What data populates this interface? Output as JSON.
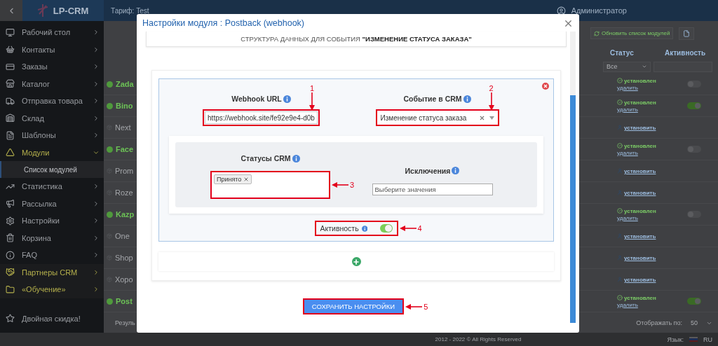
{
  "topbar": {
    "logo": "LP-CRM",
    "tariff": "Тариф: Test",
    "user": "Администратор"
  },
  "sidebar": {
    "items": [
      {
        "label": "Рабочий стол",
        "kind": "menu",
        "expanded": false
      },
      {
        "label": "Контакты",
        "kind": "menu",
        "expanded": false
      },
      {
        "label": "Заказы",
        "kind": "menu",
        "expanded": false
      },
      {
        "label": "Каталог",
        "kind": "menu",
        "expanded": false
      },
      {
        "label": "Отправка товара",
        "kind": "menu",
        "expanded": false
      },
      {
        "label": "Склад",
        "kind": "menu",
        "expanded": false
      },
      {
        "label": "Шаблоны",
        "kind": "menu",
        "expanded": false
      },
      {
        "label": "Модули",
        "kind": "accent",
        "expanded": true,
        "children": [
          {
            "label": "Список модулей",
            "selected": true
          }
        ]
      },
      {
        "label": "Статистика",
        "kind": "menu",
        "expanded": false
      },
      {
        "label": "Рассылка",
        "kind": "menu",
        "expanded": false
      },
      {
        "label": "Настройки",
        "kind": "menu",
        "expanded": false
      },
      {
        "label": "Корзина",
        "kind": "menu",
        "expanded": false
      },
      {
        "label": "FAQ",
        "kind": "menu",
        "expanded": false
      },
      {
        "label": "Партнеры CRM",
        "kind": "accent",
        "expanded": false
      },
      {
        "label": "«Обучение»",
        "kind": "accent",
        "expanded": false
      },
      {
        "label": "Двойная скидка!",
        "kind": "promo"
      }
    ]
  },
  "modules": {
    "toolbar_button": "Обновить список модулей",
    "columns": [
      "Статус",
      "Активность"
    ],
    "status_filter": "Все",
    "rows": [
      {
        "name": "Zada",
        "installed": true,
        "status": "установлен",
        "action": "удалить",
        "active": false
      },
      {
        "name": "Bino",
        "installed": true,
        "status": "установлен",
        "action": "удалить",
        "active": true
      },
      {
        "name": "Next",
        "installed": false,
        "action": "установить"
      },
      {
        "name": "Face",
        "installed": true,
        "status": "установлен",
        "action": "удалить",
        "active": false
      },
      {
        "name": "Prom",
        "installed": false,
        "action": "установить"
      },
      {
        "name": "Roze",
        "installed": false,
        "action": "установить"
      },
      {
        "name": "Kazp",
        "installed": true,
        "status": "установлен",
        "action": "удалить",
        "active": false
      },
      {
        "name": "One",
        "installed": false,
        "action": "установить"
      },
      {
        "name": "Shop",
        "installed": false,
        "action": "установить"
      },
      {
        "name": "Хоро",
        "installed": false,
        "action": "установить"
      },
      {
        "name": "Post",
        "installed": true,
        "status": "установлен",
        "action": "удалить",
        "active": true
      }
    ],
    "results_label": "Резуль",
    "page_size_label": "Отображать по:",
    "page_size": "50"
  },
  "footer": {
    "language_label": "Язык:",
    "language": "RU",
    "copyright": "2012 - 2022 © All Rights Reserved"
  },
  "modal": {
    "title": "Настройки модуля : Postback (webhook)",
    "structure_heading": "СТРУКТУРА ДАННЫХ ДЛЯ СОБЫТИЯ **\"ИЗМЕНЕНИЕ СТАТУСА ЗАКАЗА\"**",
    "webhook_url": {
      "label": "Webhook URL",
      "value": "https://webhook.site/fe92e9e4-d0b",
      "marker": {
        "number": "1"
      }
    },
    "event": {
      "label": "Событие в CRM",
      "value": "Изменение статуса заказа",
      "marker": {
        "number": "2"
      }
    },
    "statuses": {
      "label": "Статусы CRM",
      "tags": [
        "Принято"
      ],
      "marker": {
        "number": "3"
      }
    },
    "exclusions": {
      "label": "Исключения",
      "placeholder": "Выберите значения"
    },
    "activity": {
      "label": "Активность",
      "on": true,
      "marker": {
        "number": "4"
      }
    },
    "save_button": {
      "label": "СОХРАНИТЬ НАСТРОЙКИ",
      "marker": {
        "number": "5"
      }
    }
  }
}
